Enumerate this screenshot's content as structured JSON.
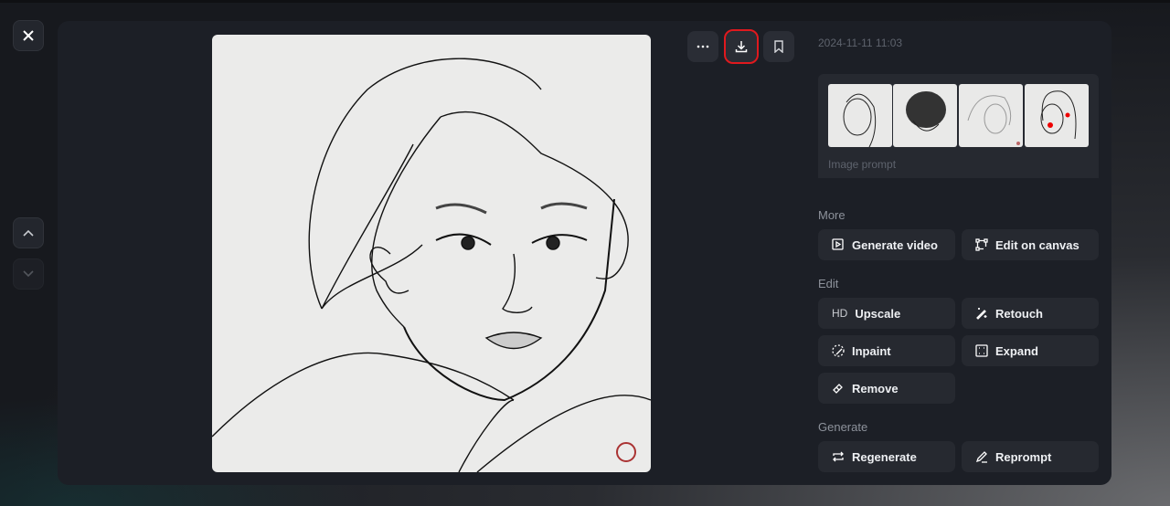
{
  "nav": {
    "close": "close",
    "prev": "previous",
    "next": "next"
  },
  "toolbar": {
    "more": "more-options",
    "download": "download",
    "bookmark": "bookmark"
  },
  "details": {
    "date": "2024-11-11 11:03",
    "image_prompt_label": "Image prompt",
    "sections": {
      "more": "More",
      "edit": "Edit",
      "generate": "Generate"
    },
    "actions": {
      "generate_video": "Generate video",
      "edit_on_canvas": "Edit on canvas",
      "upscale_prefix": "HD",
      "upscale": "Upscale",
      "retouch": "Retouch",
      "inpaint": "Inpaint",
      "expand": "Expand",
      "remove": "Remove",
      "regenerate": "Regenerate",
      "reprompt": "Reprompt"
    }
  },
  "colors": {
    "highlight": "#e0191e",
    "panel": "#1c1f26",
    "button": "#262930"
  }
}
